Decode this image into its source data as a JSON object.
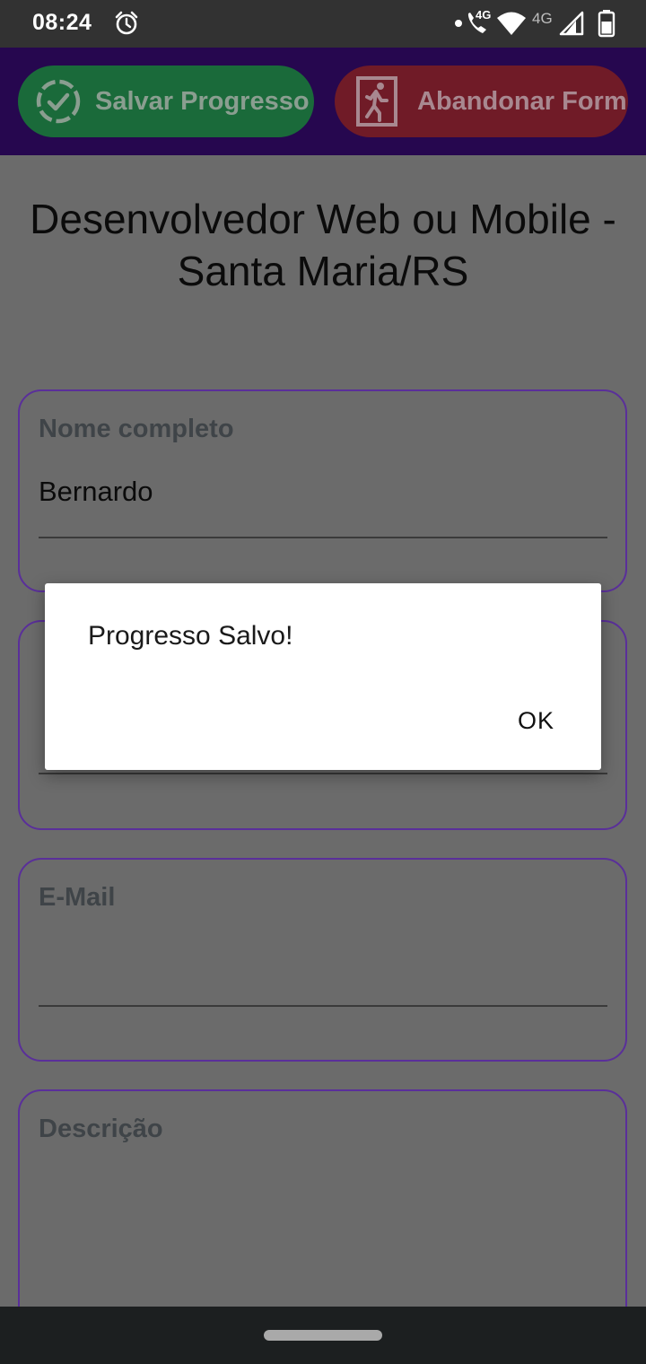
{
  "status_bar": {
    "time": "08:24",
    "network_label_1": "4G",
    "network_label_2": "4G",
    "icons": [
      "alarm-icon",
      "dot-icon",
      "phone-volte-icon",
      "wifi-icon",
      "signal-icon",
      "battery-icon"
    ]
  },
  "action_bar": {
    "save_label": "Salvar Progresso",
    "quit_label": "Abandonar Form",
    "save_color": "#1a6a3a",
    "quit_color": "#701b27",
    "bar_color": "#26074f"
  },
  "page": {
    "title_line1": "Desenvolvedor Web ou Mobile -",
    "title_line2": "Santa Maria/RS"
  },
  "form": {
    "fields": [
      {
        "label": "Nome completo",
        "value": "Bernardo"
      },
      {
        "label": "",
        "value": ""
      },
      {
        "label": "E-Mail",
        "value": ""
      },
      {
        "label": "Descrição",
        "value": ""
      }
    ]
  },
  "dialog": {
    "message": "Progresso Salvo!",
    "ok_label": "OK"
  },
  "colors": {
    "accent_border": "#5a2f9a",
    "scrim": "#6b6b6b"
  }
}
